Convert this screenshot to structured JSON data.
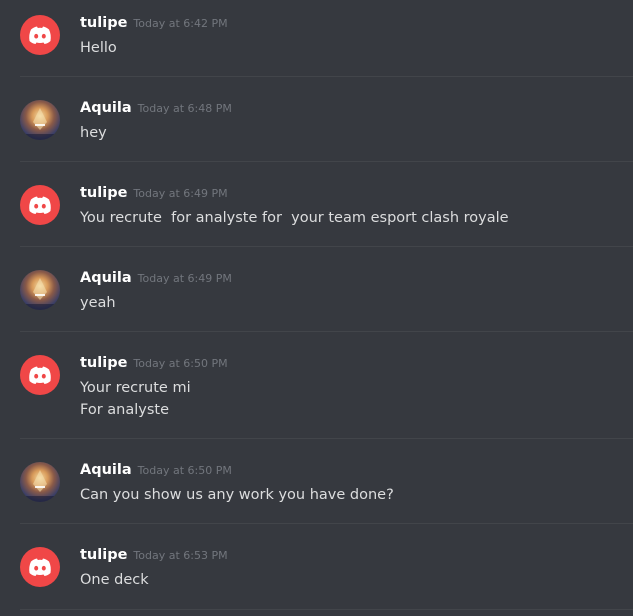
{
  "messages": [
    {
      "author": "tulipe",
      "avatar": "discord-logo-icon",
      "timestamp": "Today at 6:42 PM",
      "lines": [
        "Hello"
      ]
    },
    {
      "author": "Aquila",
      "avatar": "aquila-avatar",
      "timestamp": "Today at 6:48 PM",
      "lines": [
        "hey"
      ]
    },
    {
      "author": "tulipe",
      "avatar": "discord-logo-icon",
      "timestamp": "Today at 6:49 PM",
      "lines": [
        "You recrute  for analyste for  your team esport clash royale"
      ]
    },
    {
      "author": "Aquila",
      "avatar": "aquila-avatar",
      "timestamp": "Today at 6:49 PM",
      "lines": [
        "yeah"
      ]
    },
    {
      "author": "tulipe",
      "avatar": "discord-logo-icon",
      "timestamp": "Today at 6:50 PM",
      "lines": [
        "Your recrute mi",
        "For analyste"
      ]
    },
    {
      "author": "Aquila",
      "avatar": "aquila-avatar",
      "timestamp": "Today at 6:50 PM",
      "lines": [
        "Can you show us any work you have done?"
      ]
    },
    {
      "author": "tulipe",
      "avatar": "discord-logo-icon",
      "timestamp": "Today at 6:53 PM",
      "lines": [
        "One deck"
      ]
    }
  ],
  "colors": {
    "background": "#36393f",
    "divider": "#42454a",
    "discord_red": "#f04747",
    "username": "#ffffff",
    "timestamp": "#72767d",
    "message_text": "#dcddde"
  }
}
